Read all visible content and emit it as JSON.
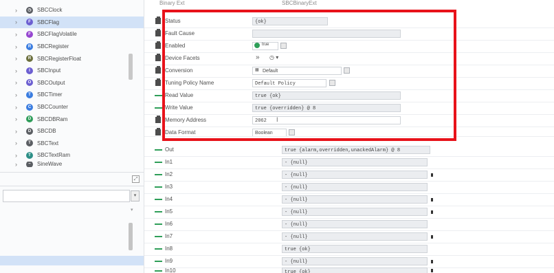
{
  "tree": {
    "items": [
      {
        "label": "SBCClock",
        "icon": "clock-icon",
        "color": "gray",
        "selected": false
      },
      {
        "label": "SBCFlag",
        "icon": "flag-icon",
        "color": "purple",
        "selected": true
      },
      {
        "label": "SBCFlagVolatile",
        "icon": "flag-volatile-icon",
        "color": "violet",
        "selected": false
      },
      {
        "label": "SBCRegister",
        "icon": "register-icon",
        "color": "blue",
        "selected": false
      },
      {
        "label": "SBCRegisterFloat",
        "icon": "register-float-icon",
        "color": "olive",
        "selected": false
      },
      {
        "label": "SBCInput",
        "icon": "input-icon",
        "color": "purple",
        "selected": false
      },
      {
        "label": "SBCOutput",
        "icon": "output-icon",
        "color": "purple",
        "selected": false
      },
      {
        "label": "SBCTimer",
        "icon": "timer-icon",
        "color": "blue",
        "selected": false
      },
      {
        "label": "SBCCounter",
        "icon": "counter-icon",
        "color": "blue",
        "selected": false
      },
      {
        "label": "SBCDBRam",
        "icon": "db-ram-icon",
        "color": "green",
        "selected": false
      },
      {
        "label": "SBCDB",
        "icon": "db-icon",
        "color": "gray",
        "selected": false
      },
      {
        "label": "SBCText",
        "icon": "text-icon",
        "color": "gray",
        "selected": false
      },
      {
        "label": "SBCTextRam",
        "icon": "text-ram-icon",
        "color": "teal",
        "selected": false
      },
      {
        "label": "SineWave",
        "icon": "sinewave-icon",
        "color": "gray",
        "selected": false
      }
    ]
  },
  "header": {
    "left": "Binary Ext",
    "right": "SBCBinaryExt"
  },
  "props": [
    {
      "label": "Status",
      "value": "{ok}"
    },
    {
      "label": "Fault Cause",
      "value": ""
    },
    {
      "label": "Enabled",
      "value": "true"
    },
    {
      "label": "Device Facets",
      "value": ""
    },
    {
      "label": "Conversion",
      "value": "Default"
    },
    {
      "label": "Tuning Policy Name",
      "value": "Default Policy"
    },
    {
      "label": "Read Value",
      "value": "true {ok}"
    },
    {
      "label": "Write Value",
      "value": "true {overridden} @ 8"
    },
    {
      "label": "Memory Address",
      "value": "2062"
    },
    {
      "label": "Data Format",
      "value": "Boolean"
    }
  ],
  "slots": [
    {
      "label": "Out",
      "value": "true {alarm,overridden,unackedAlarm} @ 8",
      "marked": false
    },
    {
      "label": "In1",
      "value": "- {null}",
      "marked": false
    },
    {
      "label": "In2",
      "value": "- {null}",
      "marked": true
    },
    {
      "label": "In3",
      "value": "- {null}",
      "marked": false
    },
    {
      "label": "In4",
      "value": "- {null}",
      "marked": true
    },
    {
      "label": "In5",
      "value": "- {null}",
      "marked": true
    },
    {
      "label": "In6",
      "value": "- {null}",
      "marked": false
    },
    {
      "label": "In7",
      "value": "- {null}",
      "marked": true
    },
    {
      "label": "In8",
      "value": "true {ok}",
      "marked": false
    },
    {
      "label": "In9",
      "value": "- {null}",
      "marked": true
    },
    {
      "label": "In10",
      "value": "true {ok}",
      "marked": true
    }
  ],
  "colors": {
    "highlight": "#e8121a",
    "selected": "#d2e2f7",
    "ok_green": "#2e9e58"
  }
}
